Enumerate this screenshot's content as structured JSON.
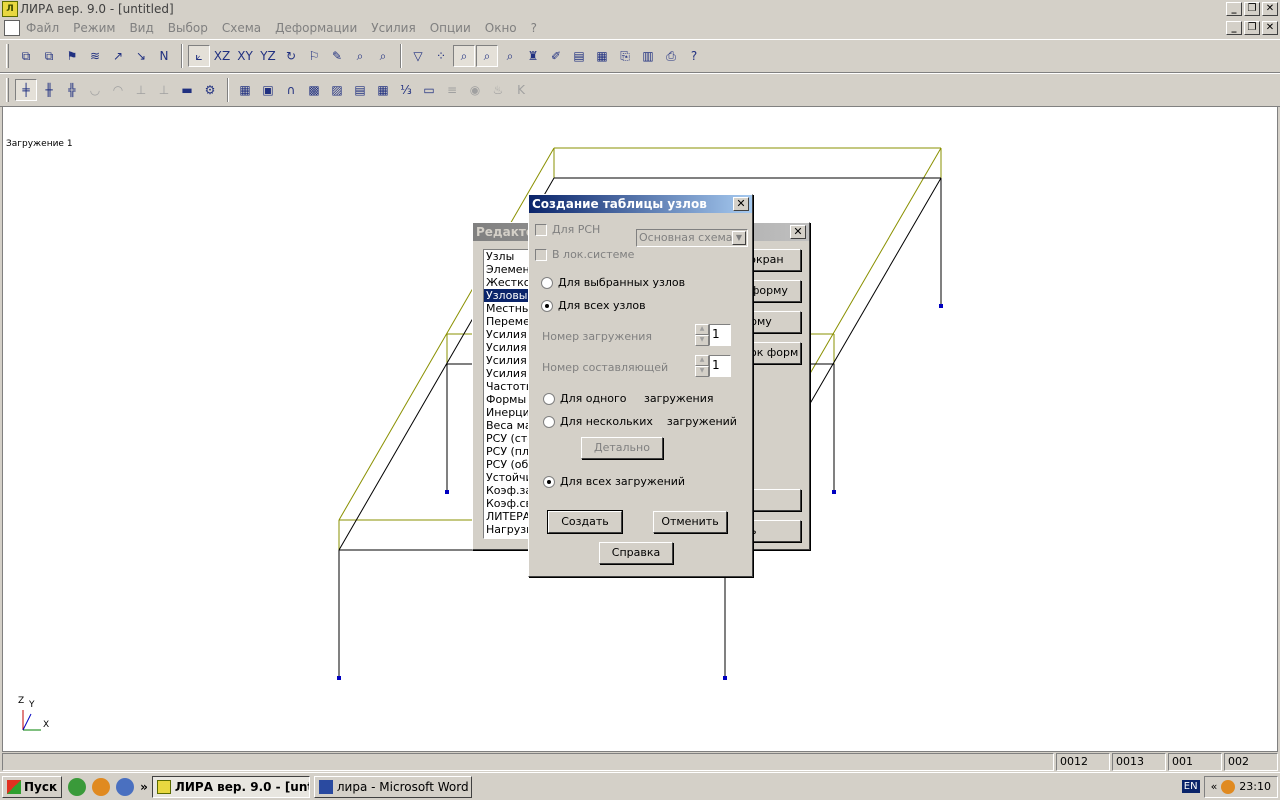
{
  "titlebar": {
    "title": "ЛИРА  вер. 9.0 - [untitled]",
    "icon": "lira-app-icon"
  },
  "menu": [
    "Файл",
    "Режим",
    "Вид",
    "Выбор",
    "Схема",
    "Деформации",
    "Усилия",
    "Опции",
    "Окно",
    "?"
  ],
  "workspace": {
    "loadcase_label": "Загружение  1",
    "axes": {
      "z": "Z",
      "y": "Y",
      "x": "X"
    }
  },
  "editor_dialog": {
    "title": "Редакто",
    "list_items": [
      "Узлы",
      "Элемент",
      "Жестко",
      "Узловы",
      "Местны",
      "Переме",
      "Усилия",
      "Усилия",
      "Усилия",
      "Усилия",
      "Частоть",
      "Формы",
      "Инерция",
      "Веса ма",
      "РСУ (сте",
      "РСУ (пла",
      "РСУ (об",
      "Устойчи",
      "Коэф.за",
      "Коэф.св",
      "ЛИТЕРА",
      "Нагрузк"
    ],
    "selected_index": 3,
    "buttons": [
      "экран",
      "форму",
      "рму",
      "ок форм",
      "",
      "ь"
    ]
  },
  "nodes_dialog": {
    "title": "Создание таблицы узлов",
    "for_rsn_label": "Для РСН",
    "local_system_label": "В лок.системе",
    "scheme_combo": "Основная схема",
    "selected_nodes_label": "Для выбранных узлов",
    "all_nodes_label": "Для всех узлов",
    "load_number_label": "Номер загружения",
    "load_number_value": "1",
    "component_number_label": "Номер составляющей",
    "component_number_value": "1",
    "one_load_label": "Для одного     загружения",
    "several_loads_label": "Для нескольких    загружений",
    "details_button": "Детально",
    "all_loads_label": "Для всех загружений",
    "create_button": "Создать",
    "cancel_button": "Отменить",
    "help_button": "Справка"
  },
  "status_cells": [
    "0012",
    "0013",
    "001",
    "002"
  ],
  "taskbar": {
    "start": "Пуск",
    "overflow": "»",
    "tasks": [
      {
        "label": "ЛИРА  вер. 9.0 - [unti...",
        "active": true
      },
      {
        "label": "лира - Microsoft Word",
        "active": false
      }
    ],
    "lang": "EN",
    "tray_chevron": "«",
    "clock": "23:10"
  },
  "colors": {
    "frame_olive": "#8a9000",
    "frame_black": "#000000",
    "node_blue": "#0000c0",
    "title_active": "#0a246a"
  }
}
